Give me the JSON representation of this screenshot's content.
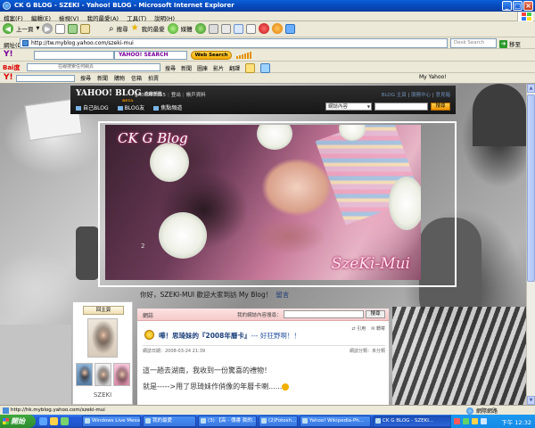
{
  "window": {
    "title": "CK G BLOG - SZEKI - Yahoo! BLOG - Microsoft Internet Explorer",
    "buttons": [
      "_",
      "□",
      "×"
    ]
  },
  "menu": {
    "items": [
      "檔案(F)",
      "編輯(E)",
      "檢視(V)",
      "我的最愛(A)",
      "工具(T)",
      "說明(H)"
    ]
  },
  "navbar": {
    "back": "上一頁",
    "search": "搜尋",
    "favorites": "我的最愛",
    "media": "媒體"
  },
  "address": {
    "label": "網址(D)",
    "url": "http://tw.myblog.yahoo.com/szeki-mui",
    "search_placeholder": "Desk Search",
    "go": "移至"
  },
  "yahoo_toolbar": {
    "logo": "Y!",
    "search_label": "YAHOO! SEARCH",
    "web_search": "Web Search"
  },
  "baidu_toolbar": {
    "logo": "Bai度",
    "input_hint": "在線搜索任何網頁",
    "items": [
      "搜尋",
      "新聞",
      "圖庫",
      "影片",
      "翻譯"
    ]
  },
  "yahoo_toolbar2": {
    "logo": "Y!",
    "items": [
      "搜尋",
      "新聞",
      "購物",
      "信箱",
      "拍賣"
    ],
    "my_yahoo": "My Yahoo!"
  },
  "blog": {
    "logo": "YAHOO! BLOG",
    "logo_sub": "奇摩部落",
    "logo_beta": "BETA",
    "user": "gn00987355",
    "logout": "登出",
    "account": "帳戶資料",
    "right_links": [
      "BLOG 主頁",
      "服務中心",
      "意見箱"
    ],
    "nav": [
      "自己BLOG",
      "BLOG友",
      "焦點頻道"
    ],
    "search_select": "網誌內容",
    "search_button": "搜尋",
    "banner_title": "CK G Blog",
    "banner_signature": "SzeKi-Mui",
    "banner_number": "2",
    "welcome": "你好，SZEKI-MUI 歡迎大家到訪 My Blog！",
    "welcome_link": "留言"
  },
  "profile": {
    "home_button": "回主頁",
    "name": "SZEKI"
  },
  "post_panel": {
    "header": "網誌",
    "search_label": "我的網誌內容搜尋：",
    "search_button": "搜尋",
    "title": "嘩！思琦妹的『2008年曆卡』",
    "title_rest": "--- 好狂野啊！！",
    "icons": [
      "引用",
      "轉寄"
    ],
    "date": "網誌日期：2008-03-24 21:39",
    "category": "網誌分類：未分類",
    "body_line1": "這一趟去湖南，我收到一份驚喜的禮物！",
    "body_line2": "就是----->用了思琦妹作俏像的年曆卡喇......"
  },
  "status": {
    "url": "http://hk.myblog.yahoo.com/szeki-mui",
    "zone": "網際網路"
  },
  "taskbar": {
    "start": "開始",
    "tasks": [
      "Windows Live Messen...",
      "我的最愛",
      "(3) 【高 - 傳書 眞的...",
      "(2)Fotosh...",
      "Yahoo! Wikipedia-Ph...",
      "CK G BLOG - SZEKI..."
    ],
    "clock": "下午 12:32"
  }
}
